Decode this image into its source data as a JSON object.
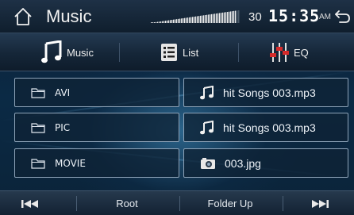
{
  "header": {
    "title": "Music",
    "volume_value": "30",
    "volume_level": 0.95,
    "clock": "15:35",
    "ampm": "AM"
  },
  "icons": {
    "home": "home-icon",
    "back": "back-arrow-icon",
    "music": "music-note-icon",
    "list": "list-icon",
    "eq": "equalizer-icon",
    "folder": "folder-icon",
    "file_music": "music-file-icon",
    "file_photo": "photo-file-icon",
    "prev": "previous-icon",
    "next": "next-icon"
  },
  "tabs": [
    {
      "label": "Music"
    },
    {
      "label": "List"
    },
    {
      "label": "EQ"
    }
  ],
  "folders": [
    {
      "name": "AVI"
    },
    {
      "name": "PIC"
    },
    {
      "name": "MOVIE"
    }
  ],
  "files": [
    {
      "name": "hit Songs 003.mp3",
      "type": "music"
    },
    {
      "name": "hit Songs 003.mp3",
      "type": "music"
    },
    {
      "name": "003.jpg",
      "type": "photo"
    }
  ],
  "bottom": {
    "root": "Root",
    "folder_up": "Folder Up"
  },
  "colors": {
    "accent_border": "#8ea3b8",
    "background": "#0b2a45"
  }
}
